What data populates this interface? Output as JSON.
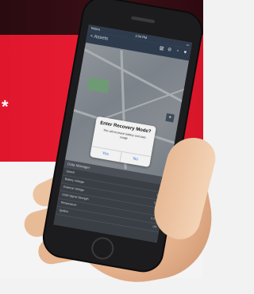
{
  "badge": {
    "symbol": "*"
  },
  "status": {
    "carrier": "Telstra",
    "time": "2:34 PM",
    "battery": ""
  },
  "nav": {
    "back_label": "< Assets",
    "icons": [
      "book-icon",
      "eye-off-icon",
      "bell-icon",
      "heart-icon"
    ]
  },
  "dialog": {
    "title": "Enter Recovery Mode?",
    "message": "This will increase battery and data usage",
    "yes_label": "Yes",
    "no_label": "No"
  },
  "panel": {
    "title": "Data Manager",
    "rows": [
      {
        "label": "Speed",
        "value": ""
      },
      {
        "label": "Battery Voltage",
        "value": "3.6v"
      },
      {
        "label": "External Voltage",
        "value": "0.0 V"
      },
      {
        "label": "GSM Signal Strength",
        "value": "4"
      },
      {
        "label": "Temperature",
        "value": "0.0 C"
      },
      {
        "label": "Ignition",
        "value": "Off"
      }
    ]
  },
  "colors": {
    "brand_red": "#e0162d",
    "dialog_button": "#2f7be0",
    "nav_bg": "#2e3b4c"
  }
}
